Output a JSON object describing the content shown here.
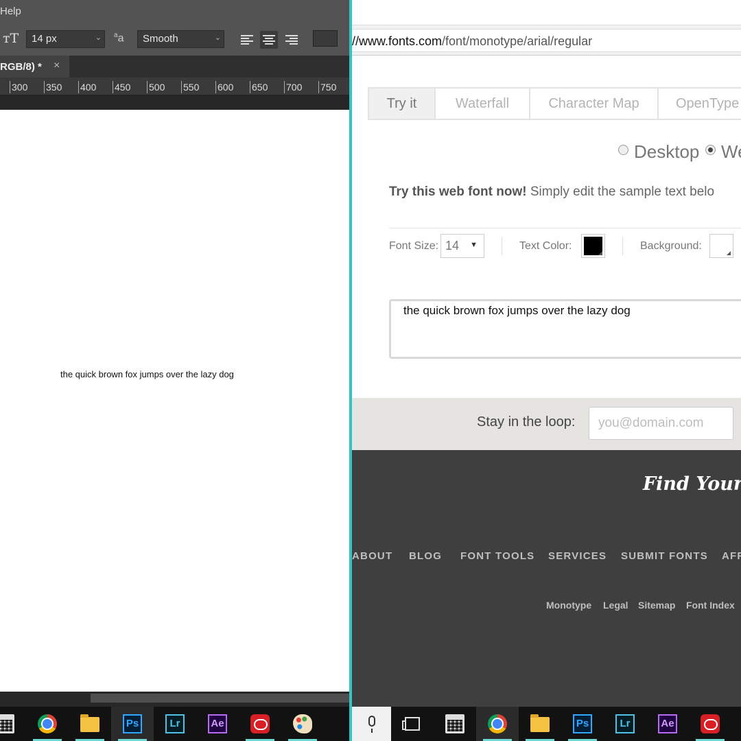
{
  "photoshop": {
    "menu": {
      "help_label": "Help"
    },
    "options_bar": {
      "font_size": "14 px",
      "anti_alias_icon_label": "a",
      "anti_alias_value": "Smooth",
      "color_swatch": "#3a3a3a"
    },
    "document_tab": {
      "title": "RGB/8) *",
      "close": "×"
    },
    "ruler_ticks": [
      "300",
      "350",
      "400",
      "450",
      "500",
      "550",
      "600",
      "650",
      "700",
      "750"
    ],
    "canvas_text": "the quick brown fox jumps over the lazy dog"
  },
  "browser": {
    "address": {
      "prefix": "//www.fonts.com",
      "path": "/font/monotype/arial/regular"
    },
    "tabs": [
      {
        "label": "Try it",
        "active": true
      },
      {
        "label": "Waterfall",
        "active": false
      },
      {
        "label": "Character Map",
        "active": false
      },
      {
        "label": "OpenType",
        "active": false
      }
    ],
    "mode": {
      "desktop_label": "Desktop",
      "web_label": "We",
      "selected": "web"
    },
    "try_line": {
      "bold": "Try this web font now!",
      "rest": " Simply edit the sample text belo"
    },
    "controls": {
      "font_size_label": "Font Size:",
      "font_size_value": "14",
      "text_color_label": "Text Color:",
      "text_color": "#000000",
      "background_label": "Background:",
      "background_color": "#ffffff"
    },
    "sample_text": "the quick brown fox jumps over the lazy dog",
    "newsletter": {
      "label": "Stay in the loop:",
      "placeholder": "you@domain.com"
    },
    "footer": {
      "tagline": "Find Your Ty",
      "nav": [
        "ABOUT",
        "BLOG",
        "FONT TOOLS",
        "SERVICES",
        "SUBMIT FONTS",
        "AFF"
      ],
      "links": [
        "Monotype",
        "Legal",
        "Sitemap",
        "Font Index"
      ]
    }
  },
  "taskbar_left": {
    "apps": [
      {
        "name": "calculator-icon",
        "label": ""
      },
      {
        "name": "chrome-icon",
        "label": ""
      },
      {
        "name": "file-explorer-icon",
        "label": ""
      },
      {
        "name": "photoshop-icon",
        "label": "Ps"
      },
      {
        "name": "lightroom-icon",
        "label": "Lr"
      },
      {
        "name": "after-effects-icon",
        "label": "Ae"
      },
      {
        "name": "creative-cloud-icon",
        "label": ""
      },
      {
        "name": "paint-icon",
        "label": ""
      }
    ]
  },
  "taskbar_right": {
    "apps": [
      {
        "name": "microphone-icon",
        "label": ""
      },
      {
        "name": "task-view-icon",
        "label": ""
      },
      {
        "name": "calculator-icon",
        "label": ""
      },
      {
        "name": "chrome-icon",
        "label": ""
      },
      {
        "name": "file-explorer-icon",
        "label": ""
      },
      {
        "name": "photoshop-icon",
        "label": "Ps"
      },
      {
        "name": "lightroom-icon",
        "label": "Lr"
      },
      {
        "name": "after-effects-icon",
        "label": "Ae"
      },
      {
        "name": "creative-cloud-icon",
        "label": ""
      }
    ]
  },
  "colors": {
    "divider": "#31c6c1",
    "ps_blue": "#31a8ff",
    "lr_blue": "#4cc2e4",
    "ae_purple": "#b66bf2",
    "taskbar_underline": "#6fd8d2"
  }
}
